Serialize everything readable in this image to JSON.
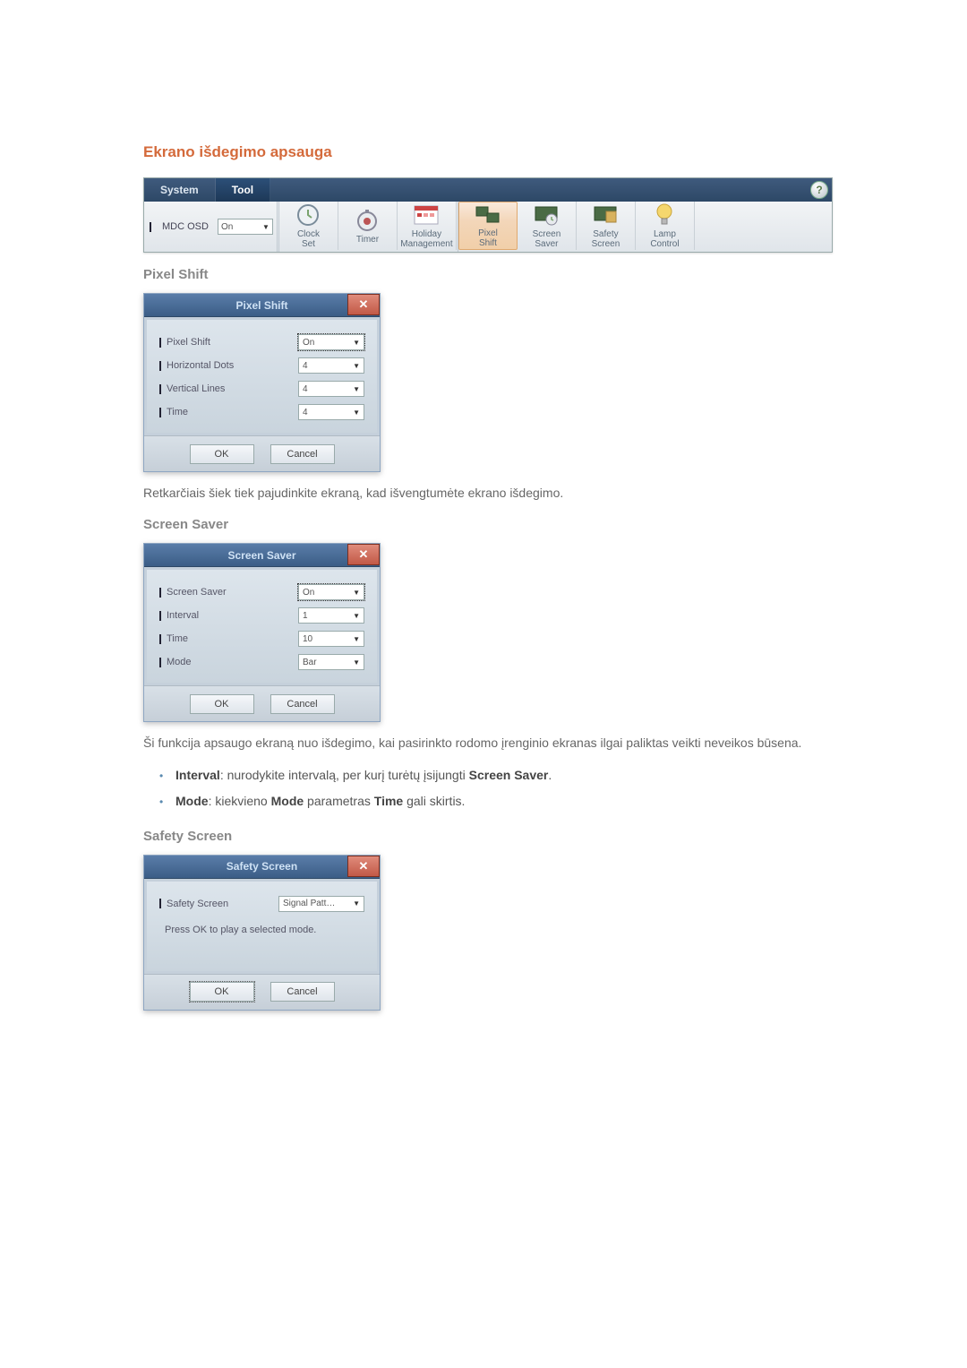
{
  "section_title": "Ekrano išdegimo apsauga",
  "toolbar": {
    "tabs": {
      "system": "System",
      "tool": "Tool"
    },
    "mdc_osd": {
      "label": "MDC OSD",
      "value": "On"
    },
    "help": "?",
    "buttons": {
      "clock_set": "Clock\nSet",
      "timer": "Timer",
      "holiday": "Holiday\nManagement",
      "pixel_shift": "Pixel\nShift",
      "screen_saver": "Screen\nSaver",
      "safety_screen": "Safety\nScreen",
      "lamp_control": "Lamp\nControl"
    }
  },
  "pixel_shift_title": "Pixel Shift",
  "dlg_pixel_shift": {
    "title": "Pixel Shift",
    "fields": {
      "pixel_shift": {
        "label": "Pixel Shift",
        "value": "On"
      },
      "horizontal": {
        "label": "Horizontal Dots",
        "value": "4"
      },
      "vertical": {
        "label": "Vertical Lines",
        "value": "4"
      },
      "time": {
        "label": "Time",
        "value": "4"
      }
    },
    "ok": "OK",
    "cancel": "Cancel"
  },
  "pixel_shift_desc": "Retkarčiais šiek tiek pajudinkite ekraną, kad išvengtumėte ekrano išdegimo.",
  "screen_saver_title": "Screen Saver",
  "dlg_screen_saver": {
    "title": "Screen Saver",
    "fields": {
      "screen_saver": {
        "label": "Screen Saver",
        "value": "On"
      },
      "interval": {
        "label": "Interval",
        "value": "1"
      },
      "time": {
        "label": "Time",
        "value": "10"
      },
      "mode": {
        "label": "Mode",
        "value": "Bar"
      }
    },
    "ok": "OK",
    "cancel": "Cancel"
  },
  "screen_saver_desc": "Ši funkcija apsaugo ekraną nuo išdegimo, kai pasirinkto rodomo įrenginio ekranas ilgai paliktas veikti neveikos būsena.",
  "bullets": {
    "interval_label": "Interval",
    "interval_text": ": nurodykite intervalą, per kurį turėtų įsijungti ",
    "interval_bold2": "Screen Saver",
    "mode_label": "Mode",
    "mode_text1": ": kiekvieno ",
    "mode_bold2": "Mode",
    "mode_text2": " parametras ",
    "mode_bold3": "Time",
    "mode_text3": " gali skirtis."
  },
  "safety_screen_title": "Safety Screen",
  "dlg_safety_screen": {
    "title": "Safety Screen",
    "fields": {
      "safety_screen": {
        "label": "Safety Screen",
        "value": "Signal Patt…"
      }
    },
    "message": "Press OK to play a selected mode.",
    "ok": "OK",
    "cancel": "Cancel"
  }
}
